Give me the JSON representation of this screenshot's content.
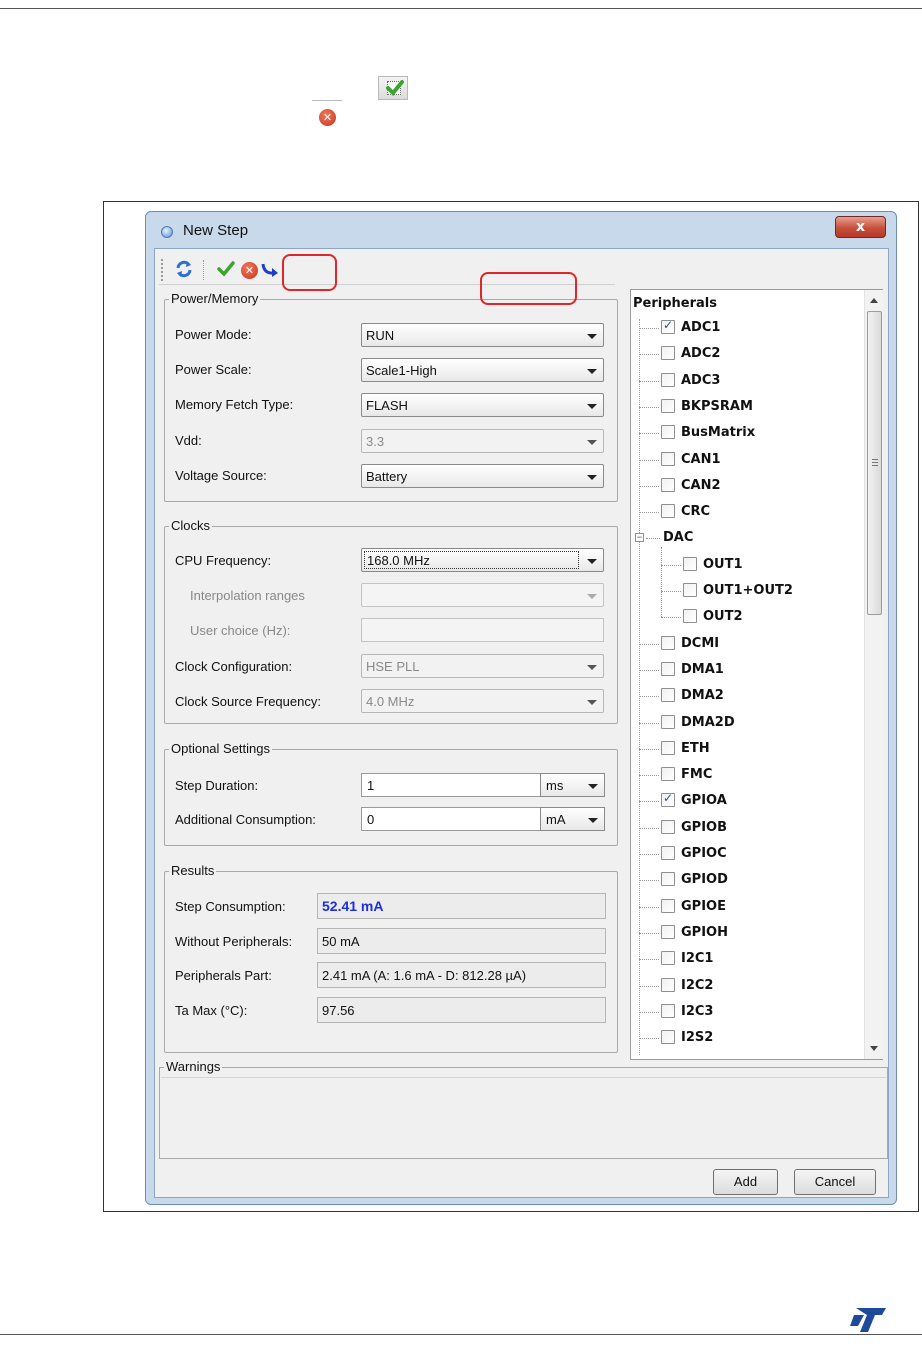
{
  "dialog": {
    "title": "New Step",
    "close_glyph": "x"
  },
  "toolbar": {
    "icons": [
      "refresh-icon",
      "check-icon",
      "cancel-icon",
      "import-icon"
    ]
  },
  "power_memory": {
    "legend": "Power/Memory",
    "power_mode_label": "Power Mode:",
    "power_mode_value": "RUN",
    "power_scale_label": "Power Scale:",
    "power_scale_value": "Scale1-High",
    "memory_fetch_label": "Memory Fetch Type:",
    "memory_fetch_value": "FLASH",
    "vdd_label": "Vdd:",
    "vdd_value": "3.3",
    "voltage_source_label": "Voltage Source:",
    "voltage_source_value": "Battery"
  },
  "clocks": {
    "legend": "Clocks",
    "cpu_freq_label": "CPU Frequency:",
    "cpu_freq_value": "168.0 MHz",
    "interp_label": "Interpolation ranges",
    "user_choice_label": "User choice (Hz):",
    "clock_config_label": "Clock Configuration:",
    "clock_config_value": "HSE PLL",
    "clock_source_label": "Clock Source Frequency:",
    "clock_source_value": "4.0 MHz"
  },
  "optional": {
    "legend": "Optional Settings",
    "step_duration_label": "Step Duration:",
    "step_duration_value": "1",
    "step_duration_unit": "ms",
    "additional_label": "Additional Consumption:",
    "additional_value": "0",
    "additional_unit": "mA"
  },
  "results": {
    "legend": "Results",
    "step_consumption_label": "Step Consumption:",
    "step_consumption_value": "52.41 mA",
    "without_periph_label": "Without Peripherals:",
    "without_periph_value": "50 mA",
    "periph_part_label": "Peripherals Part:",
    "periph_part_value": "2.41 mA  (A: 1.6 mA - D: 812.28 µA)",
    "ta_max_label": "Ta Max (°C):",
    "ta_max_value": "97.56"
  },
  "peripherals": {
    "header": "Peripherals",
    "items": [
      {
        "label": "ADC1",
        "checked": true,
        "level": 0
      },
      {
        "label": "ADC2",
        "checked": false,
        "level": 0
      },
      {
        "label": "ADC3",
        "checked": false,
        "level": 0
      },
      {
        "label": "BKPSRAM",
        "checked": false,
        "level": 0
      },
      {
        "label": "BusMatrix",
        "checked": false,
        "level": 0
      },
      {
        "label": "CAN1",
        "checked": false,
        "level": 0
      },
      {
        "label": "CAN2",
        "checked": false,
        "level": 0
      },
      {
        "label": "CRC",
        "checked": false,
        "level": 0
      },
      {
        "label": "DAC",
        "checked": false,
        "level": 0,
        "group": true
      },
      {
        "label": "OUT1",
        "checked": false,
        "level": 1
      },
      {
        "label": "OUT1+OUT2",
        "checked": false,
        "level": 1
      },
      {
        "label": "OUT2",
        "checked": false,
        "level": 1
      },
      {
        "label": "DCMI",
        "checked": false,
        "level": 0
      },
      {
        "label": "DMA1",
        "checked": false,
        "level": 0
      },
      {
        "label": "DMA2",
        "checked": false,
        "level": 0
      },
      {
        "label": "DMA2D",
        "checked": false,
        "level": 0
      },
      {
        "label": "ETH",
        "checked": false,
        "level": 0
      },
      {
        "label": "FMC",
        "checked": false,
        "level": 0
      },
      {
        "label": "GPIOA",
        "checked": true,
        "level": 0
      },
      {
        "label": "GPIOB",
        "checked": false,
        "level": 0
      },
      {
        "label": "GPIOC",
        "checked": false,
        "level": 0
      },
      {
        "label": "GPIOD",
        "checked": false,
        "level": 0
      },
      {
        "label": "GPIOE",
        "checked": false,
        "level": 0
      },
      {
        "label": "GPIOH",
        "checked": false,
        "level": 0
      },
      {
        "label": "I2C1",
        "checked": false,
        "level": 0
      },
      {
        "label": "I2C2",
        "checked": false,
        "level": 0
      },
      {
        "label": "I2C3",
        "checked": false,
        "level": 0
      },
      {
        "label": "I2S2",
        "checked": false,
        "level": 0
      }
    ]
  },
  "warnings": {
    "legend": "Warnings"
  },
  "buttons": {
    "add": "Add",
    "cancel": "Cancel"
  },
  "colors": {
    "highlight": "#e0262a",
    "result_blue": "#1c2ee0",
    "st_logo": "#1e4a9a"
  },
  "logo": "ST"
}
